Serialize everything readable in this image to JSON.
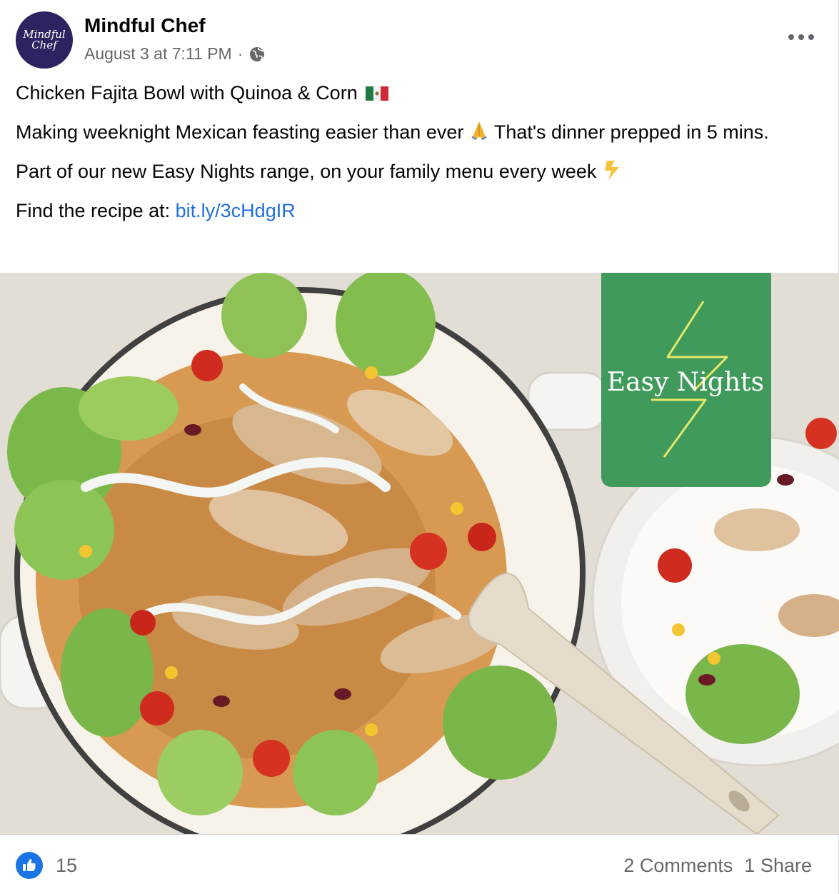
{
  "post": {
    "page_name": "Mindful Chef",
    "avatar_text": "Mindful Chef",
    "timestamp": "August 3 at 7:11 PM",
    "separator": "·",
    "privacy_icon": "globe-icon",
    "more_icon": "more-options-icon",
    "paragraphs": {
      "title": "Chicken Fajita Bowl with Quinoa & Corn",
      "title_emoji": "mexico-flag-icon",
      "line2_before": "Making weeknight Mexican feasting easier than ever",
      "line2_emoji": "folded-hands-icon",
      "line2_after": "That's dinner prepped in 5 mins.",
      "line3": "Part of our new Easy Nights range, on your family menu every week",
      "line3_emoji": "lightning-icon",
      "line4_label": "Find the recipe at:",
      "line4_link": "bit.ly/3cHdgIR"
    },
    "image": {
      "badge_text": "Easy Nights",
      "badge_color": "#3f9a5b",
      "bolt_color": "#e6e86a"
    },
    "footer": {
      "like_count": "15",
      "comments": "2 Comments",
      "shares": "1 Share"
    },
    "colors": {
      "link": "#216fdb",
      "secondary_text": "#65676b",
      "like_blue": "#1b74e4",
      "avatar_bg": "#2e2361"
    }
  }
}
